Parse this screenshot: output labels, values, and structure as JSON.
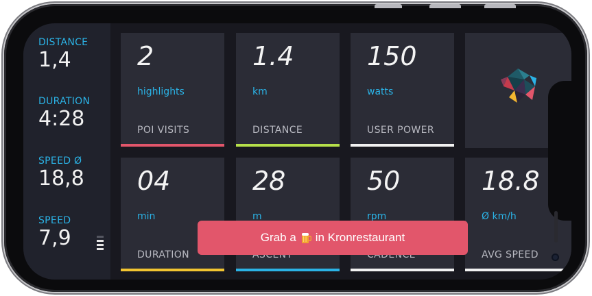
{
  "sidebar": {
    "stats": [
      {
        "label": "DISTANCE",
        "value": "1,4"
      },
      {
        "label": "DURATION",
        "value": "4:28"
      },
      {
        "label": "SPEED Ø",
        "value": "18,8"
      },
      {
        "label": "SPEED",
        "value": "7,9"
      }
    ]
  },
  "tiles": [
    {
      "value": "2",
      "unit": "highlights",
      "caption": "POI VISITS",
      "color": "#e2566b"
    },
    {
      "value": "1.4",
      "unit": "km",
      "caption": "DISTANCE",
      "color": "#b6e04a"
    },
    {
      "value": "150",
      "unit": "watts",
      "caption": "USER POWER",
      "color": "#f2f2f2"
    },
    {
      "value": "04",
      "unit": "min",
      "caption": "DURATION",
      "color": "#f2c531"
    },
    {
      "value": "28",
      "unit": "m",
      "caption": "ASCENT",
      "color": "#2bb3e6"
    },
    {
      "value": "50",
      "unit": "rpm",
      "caption": "CADENCE",
      "color": "#f2f2f2"
    },
    {
      "value": "18.8",
      "unit": "Ø km/h",
      "caption": "AVG SPEED",
      "color": "#f2f2f2"
    }
  ],
  "toast": {
    "before": "Grab a",
    "after": "in Kronrestaurant",
    "icon": "beer-icon"
  }
}
